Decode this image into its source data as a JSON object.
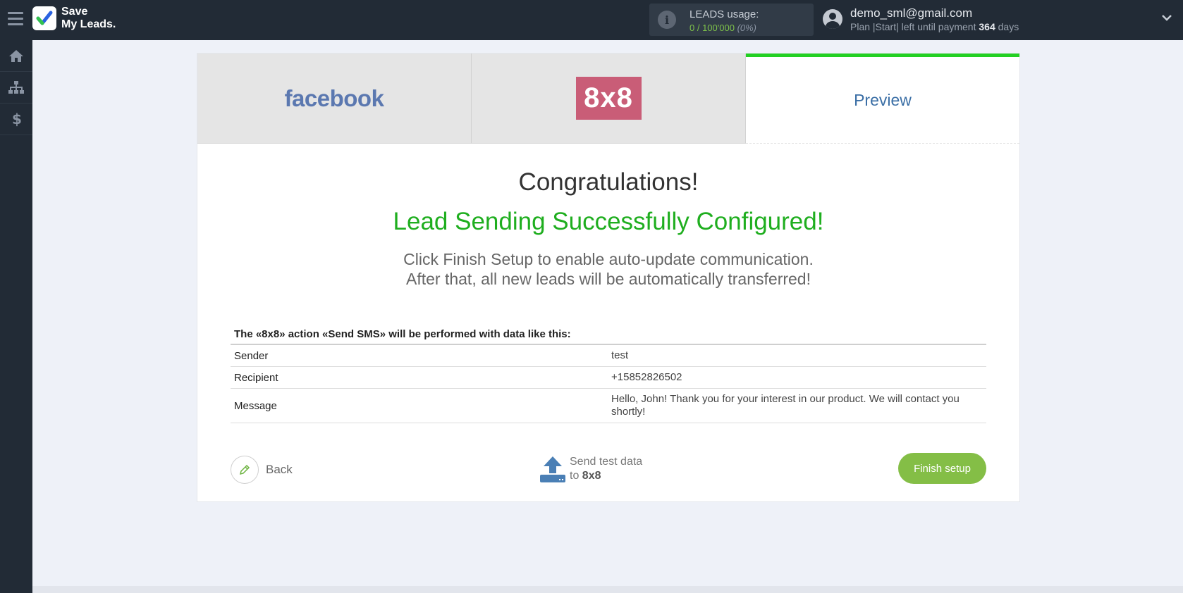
{
  "app": {
    "logo_line1": "Save",
    "logo_line2": "My Leads."
  },
  "usage": {
    "title": "LEADS usage:",
    "value": "0 / 100'000",
    "percent": "(0%)"
  },
  "user": {
    "email": "demo_sml@gmail.com",
    "plan_prefix": "Plan |Start| left until payment",
    "days": "364",
    "days_suffix": "days"
  },
  "tabs": {
    "source": "facebook",
    "destination": "8x8",
    "preview": "Preview"
  },
  "main": {
    "congrats": "Congratulations!",
    "success": "Lead Sending Successfully Configured!",
    "instruction_line1": "Click Finish Setup to enable auto-update communication.",
    "instruction_line2": "After that, all new leads will be automatically transferred!"
  },
  "table": {
    "caption": "The «8x8» action «Send SMS» will be performed with data like this:",
    "rows": [
      {
        "label": "Sender",
        "value": "test"
      },
      {
        "label": "Recipient",
        "value": "+15852826502"
      },
      {
        "label": "Message",
        "value": "Hello, John! Thank you for your interest in our product. We will contact you shortly!"
      }
    ]
  },
  "actions": {
    "back": "Back",
    "send_line1": "Send test data",
    "send_to": "to",
    "send_target": "8x8",
    "finish": "Finish setup"
  },
  "colors": {
    "success_green": "#1fae1f",
    "accent_green_bar": "#22d022",
    "finish_button": "#84be46",
    "preview_blue": "#3a6ea5"
  }
}
